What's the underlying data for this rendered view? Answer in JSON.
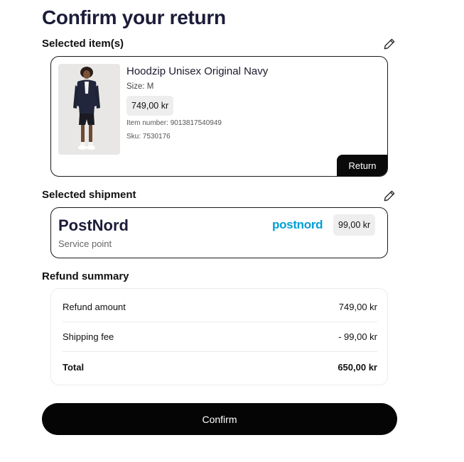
{
  "page": {
    "title": "Confirm your return"
  },
  "items_section": {
    "title": "Selected item(s)",
    "edit_icon": "pencil-icon",
    "item": {
      "name": "Hoodzip Unisex Original Navy",
      "size": "Size: M",
      "price": "749,00 kr",
      "item_number": "Item number: 9013817540949",
      "sku": "Sku: 7530176",
      "action_badge": "Return"
    }
  },
  "shipment_section": {
    "title": "Selected shipment",
    "edit_icon": "pencil-icon",
    "carrier": "PostNord",
    "service": "Service point",
    "logo_text": "postnord",
    "price": "99,00 kr"
  },
  "refund_summary": {
    "title": "Refund summary",
    "rows": [
      {
        "label": "Refund amount",
        "value": "749,00 kr"
      },
      {
        "label": "Shipping fee",
        "value": "- 99,00 kr"
      },
      {
        "label": "Total",
        "value": "650,00 kr"
      }
    ]
  },
  "actions": {
    "confirm_label": "Confirm"
  },
  "colors": {
    "title": "#1c1c3a",
    "primary_button": "#050505",
    "postnord_brand": "#00a0d6",
    "chip_bg": "#eeeeee"
  }
}
